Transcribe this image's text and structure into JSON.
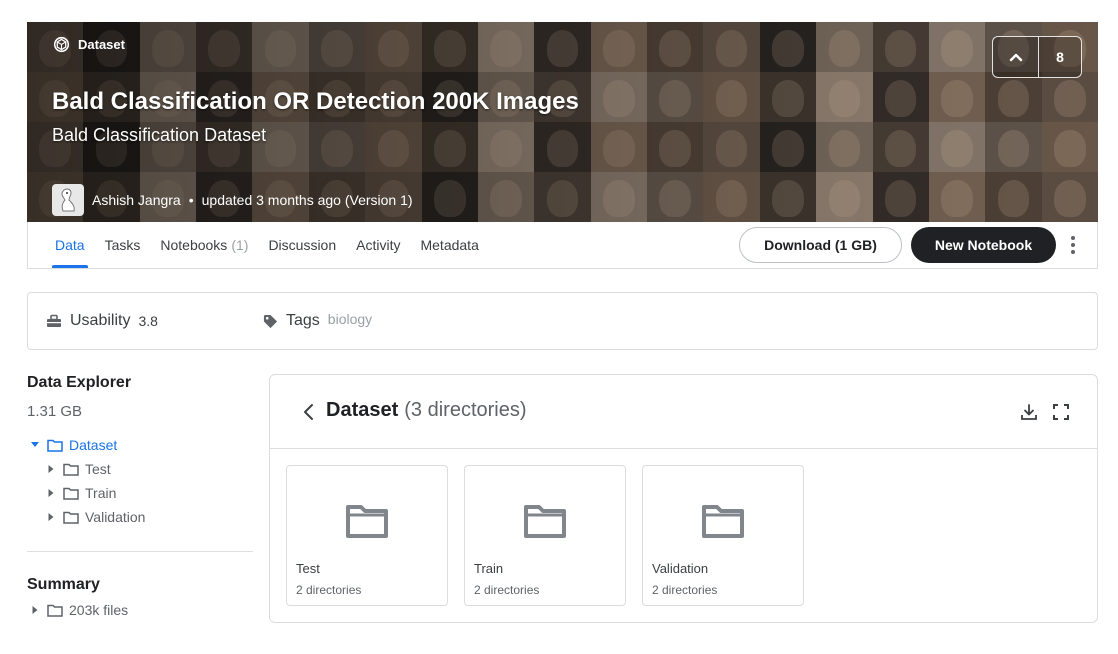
{
  "header": {
    "badge": "Dataset",
    "title": "Bald Classification OR Detection 200K Images",
    "subtitle": "Bald Classification Dataset",
    "author": "Ashish Jangra",
    "updated": "updated 3 months ago (Version 1)",
    "upvotes": "8"
  },
  "tabs": [
    {
      "label": "Data"
    },
    {
      "label": "Tasks"
    },
    {
      "label": "Notebooks",
      "count": "(1)"
    },
    {
      "label": "Discussion"
    },
    {
      "label": "Activity"
    },
    {
      "label": "Metadata"
    }
  ],
  "actions": {
    "download": "Download (1 GB)",
    "new_notebook": "New Notebook"
  },
  "usability": {
    "label": "Usability",
    "score": "3.8",
    "tags_label": "Tags",
    "tag": "biology"
  },
  "explorer": {
    "title": "Data Explorer",
    "size": "1.31 GB",
    "root": "Dataset",
    "children": [
      "Test",
      "Train",
      "Validation"
    ],
    "summary_title": "Summary",
    "summary_files": "203k files"
  },
  "panel": {
    "title": "Dataset",
    "count": "(3 directories)",
    "cards": [
      {
        "name": "Test",
        "sub": "2 directories"
      },
      {
        "name": "Train",
        "sub": "2 directories"
      },
      {
        "name": "Validation",
        "sub": "2 directories"
      }
    ]
  },
  "colors": {
    "accent": "#1a73e8",
    "dark_button": "#202124",
    "border": "#dadce0"
  }
}
